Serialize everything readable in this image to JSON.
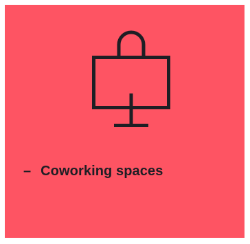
{
  "card": {
    "background_color": "#fe5463",
    "ink_color": "#1e1e24",
    "icon": "monitor-with-arch-icon",
    "bullet": "–",
    "label": "Coworking spaces"
  }
}
